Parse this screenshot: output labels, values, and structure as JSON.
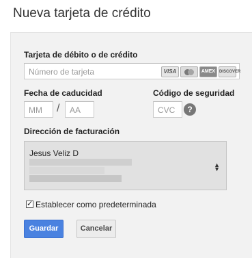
{
  "dialog": {
    "title": "Nueva tarjeta de crédito"
  },
  "card_number": {
    "label": "Tarjeta de débito o de crédito",
    "placeholder": "Número de tarjeta",
    "brands": [
      "VISA",
      "MasterCard",
      "AMEX",
      "DISCOVER"
    ]
  },
  "expiry": {
    "label": "Fecha de caducidad",
    "month_placeholder": "MM",
    "separator": "/",
    "year_placeholder": "AA"
  },
  "security": {
    "label": "Código de seguridad",
    "placeholder": "CVC",
    "help": "?"
  },
  "billing": {
    "label": "Dirección de facturación",
    "selected_name": "Jesus Veliz D"
  },
  "default_checkbox": {
    "label": "Establecer como predeterminada",
    "checked": true
  },
  "buttons": {
    "save": "Guardar",
    "cancel": "Cancelar"
  },
  "colors": {
    "primary_button": "#4a82e0",
    "panel_background": "#f2f2f2"
  }
}
